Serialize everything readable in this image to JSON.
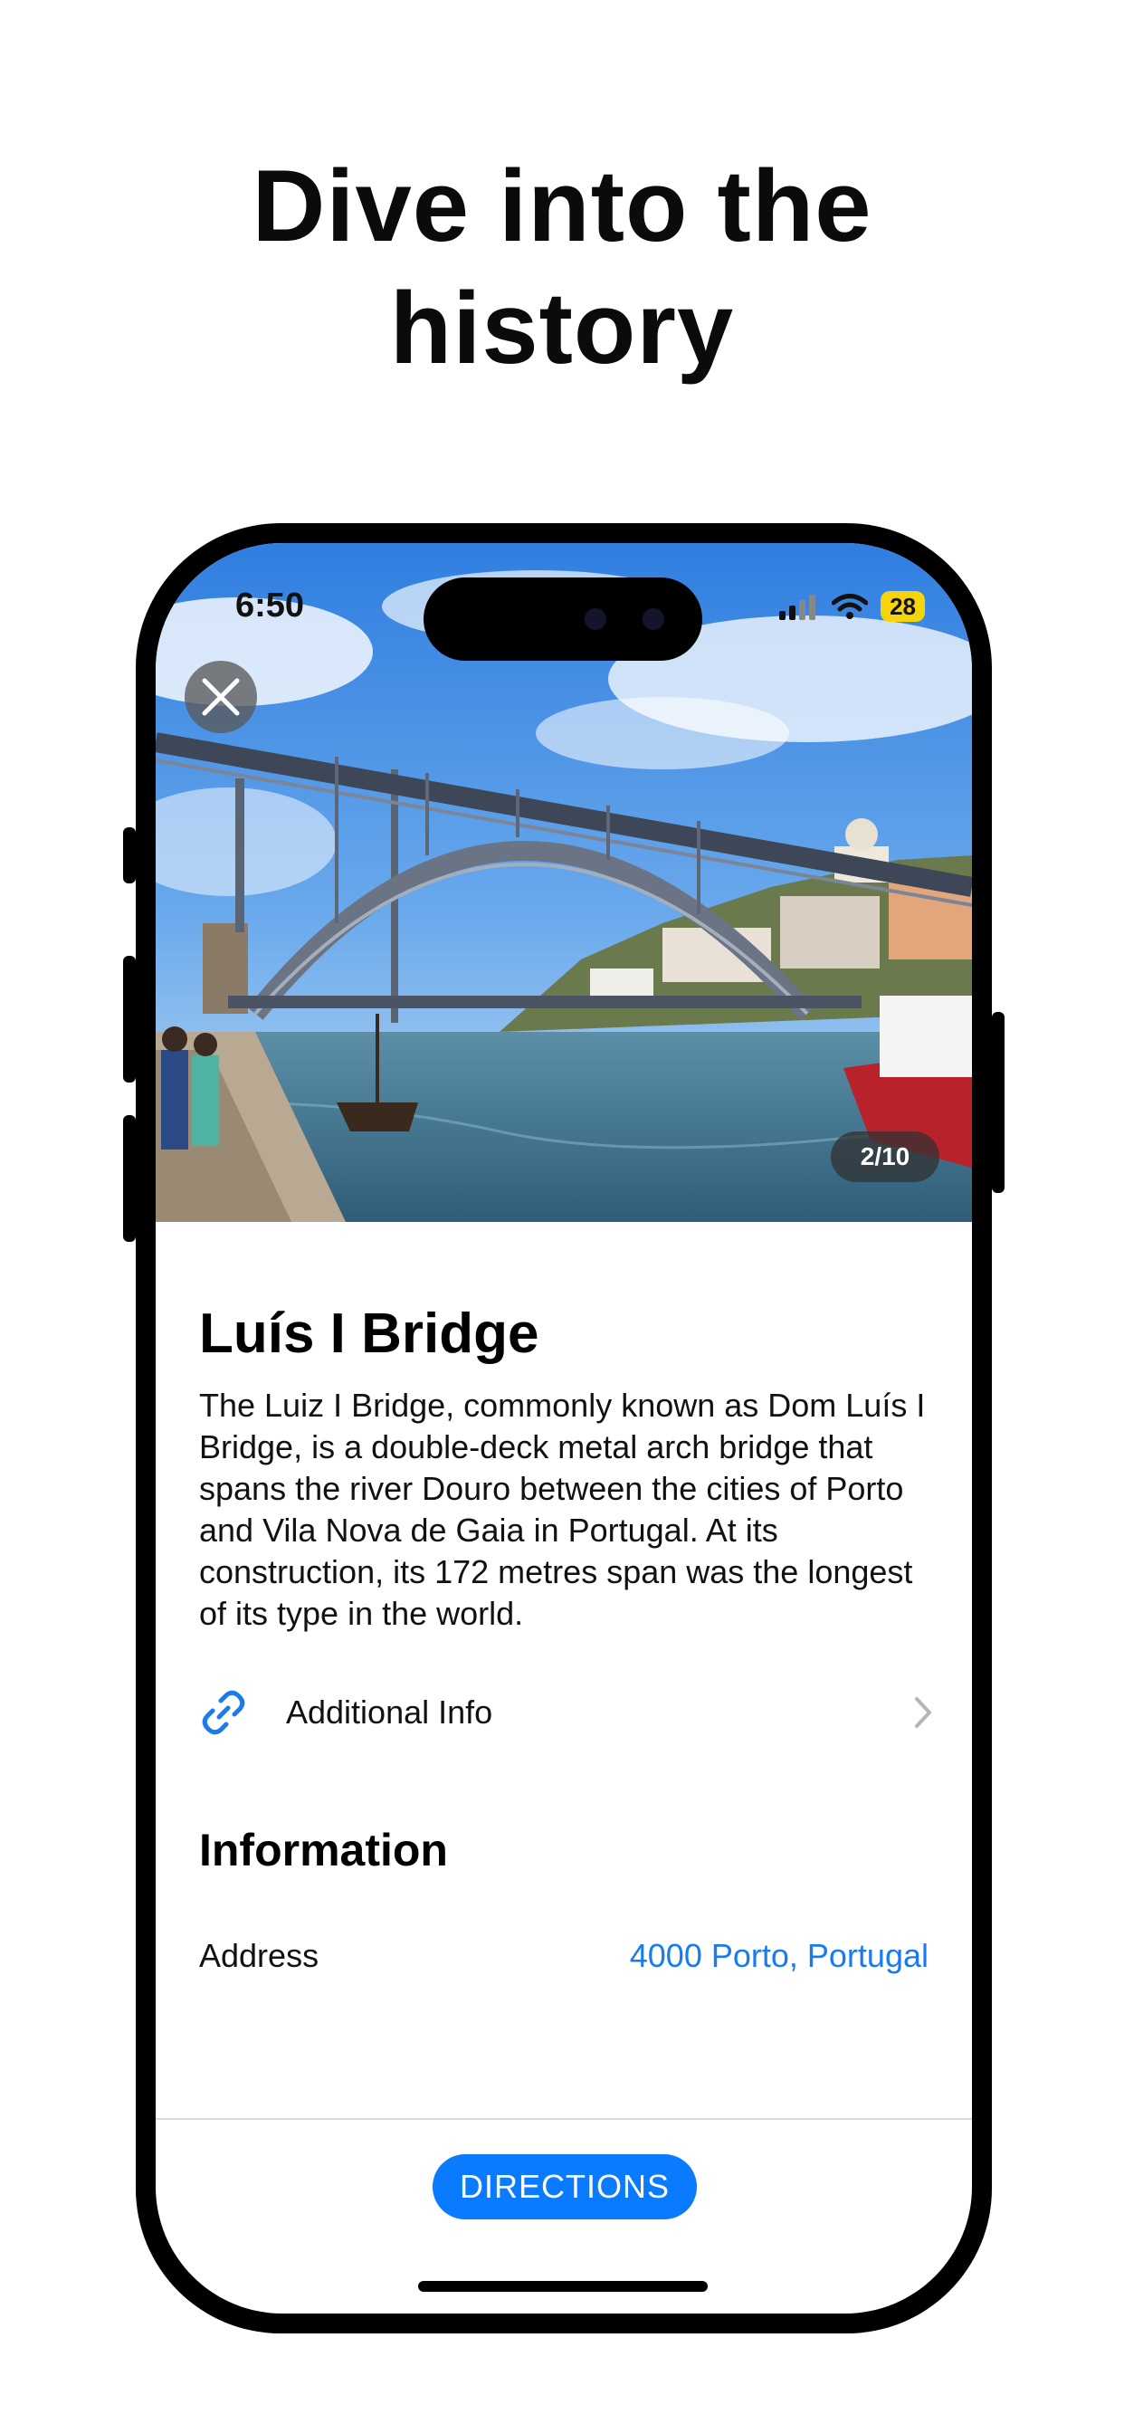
{
  "promo": {
    "headline_line1": "Dive into the",
    "headline_line2": "history"
  },
  "status_bar": {
    "time": "6:50",
    "battery": "28"
  },
  "gallery": {
    "counter": "2/10",
    "close_icon": "close-icon",
    "photo": "photo of a double-deck metal arch bridge over a river with boats and city buildings"
  },
  "place": {
    "title": "Luís I Bridge",
    "description": "The Luiz I Bridge, commonly known as Dom Luís I Bridge, is a double-deck metal arch bridge that spans the river Douro between the cities of Porto and Vila Nova de Gaia in Portugal. At its construction, its 172 metres span was the longest of its type in the world."
  },
  "additional_info": {
    "label": "Additional Info",
    "icon": "link-icon",
    "chevron": "chevron-right-icon"
  },
  "information": {
    "heading": "Information",
    "address_label": "Address",
    "address_value": "4000 Porto, Portugal"
  },
  "footer": {
    "directions_label": "DIRECTIONS"
  },
  "colors": {
    "accent": "#0a7aff",
    "link_text": "#1a7af0",
    "battery": "#f5d40b"
  }
}
